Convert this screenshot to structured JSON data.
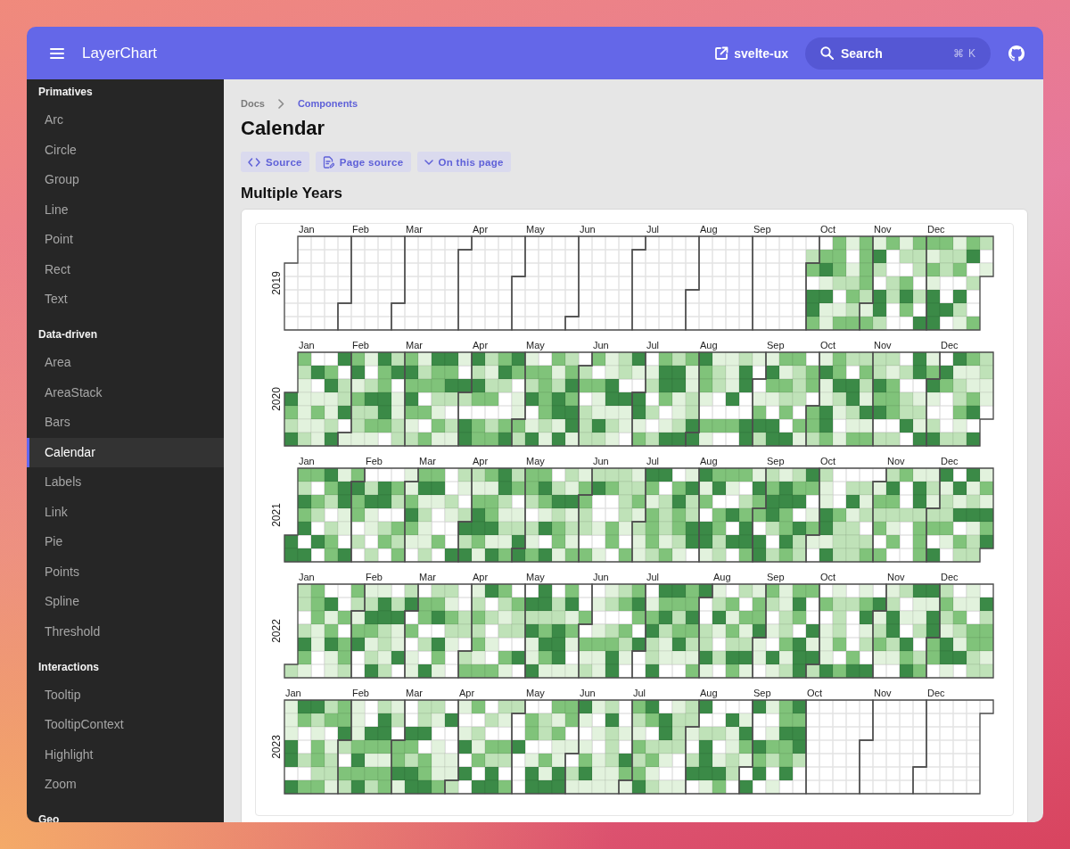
{
  "header": {
    "title": "LayerChart",
    "link": "svelte-ux",
    "search": {
      "label": "Search",
      "shortcut": "⌘ K"
    }
  },
  "sidebar": {
    "sections": [
      {
        "title": "Primatives",
        "items": [
          {
            "label": "Arc",
            "selected": false
          },
          {
            "label": "Circle",
            "selected": false
          },
          {
            "label": "Group",
            "selected": false
          },
          {
            "label": "Line",
            "selected": false
          },
          {
            "label": "Point",
            "selected": false
          },
          {
            "label": "Rect",
            "selected": false
          },
          {
            "label": "Text",
            "selected": false
          }
        ]
      },
      {
        "title": "Data-driven",
        "items": [
          {
            "label": "Area",
            "selected": false
          },
          {
            "label": "AreaStack",
            "selected": false
          },
          {
            "label": "Bars",
            "selected": false
          },
          {
            "label": "Calendar",
            "selected": true
          },
          {
            "label": "Labels",
            "selected": false
          },
          {
            "label": "Link",
            "selected": false
          },
          {
            "label": "Pie",
            "selected": false
          },
          {
            "label": "Points",
            "selected": false
          },
          {
            "label": "Spline",
            "selected": false
          },
          {
            "label": "Threshold",
            "selected": false
          }
        ]
      },
      {
        "title": "Interactions",
        "items": [
          {
            "label": "Tooltip",
            "selected": false
          },
          {
            "label": "TooltipContext",
            "selected": false
          },
          {
            "label": "Highlight",
            "selected": false
          },
          {
            "label": "Zoom",
            "selected": false
          }
        ]
      },
      {
        "title": "Geo"
      }
    ]
  },
  "breadcrumb": [
    "Docs",
    "Components"
  ],
  "page": {
    "title": "Calendar",
    "actions": [
      {
        "kind": "code",
        "label": "Source"
      },
      {
        "kind": "document",
        "label": "Page source"
      },
      {
        "kind": "dropdown",
        "label": "On this page"
      }
    ]
  },
  "example": {
    "title": "Multiple Years",
    "calendar": {
      "years": [
        {
          "label": "2019",
          "months": [
            "Jan",
            "Feb",
            "Mar",
            "Apr",
            "May",
            "Jun",
            "Jul",
            "Aug",
            "Sep",
            "Oct",
            "Nov",
            "Dec"
          ]
        },
        {
          "label": "2020",
          "months": [
            "Jan",
            "Feb",
            "Mar",
            "Apr",
            "May",
            "Jun",
            "Jul",
            "Aug",
            "Sep",
            "Oct",
            "Nov",
            "Dec"
          ]
        },
        {
          "label": "2021",
          "months": [
            "Jan",
            "Feb",
            "Mar",
            "Apr",
            "May",
            "Jun",
            "Jul",
            "Aug",
            "Sep",
            "Oct",
            "Nov",
            "Dec"
          ]
        },
        {
          "label": "2022",
          "months": [
            "Jan",
            "Feb",
            "Mar",
            "Apr",
            "May",
            "Jun",
            "Jul",
            "Aug",
            "Sep",
            "Oct",
            "Nov",
            "Dec"
          ]
        },
        {
          "label": "2023",
          "months": [
            "Jan",
            "Feb",
            "Mar",
            "Apr",
            "May",
            "Jun",
            "Jul",
            "Aug",
            "Sep",
            "Oct",
            "Nov",
            "Dec"
          ]
        }
      ]
    }
  }
}
